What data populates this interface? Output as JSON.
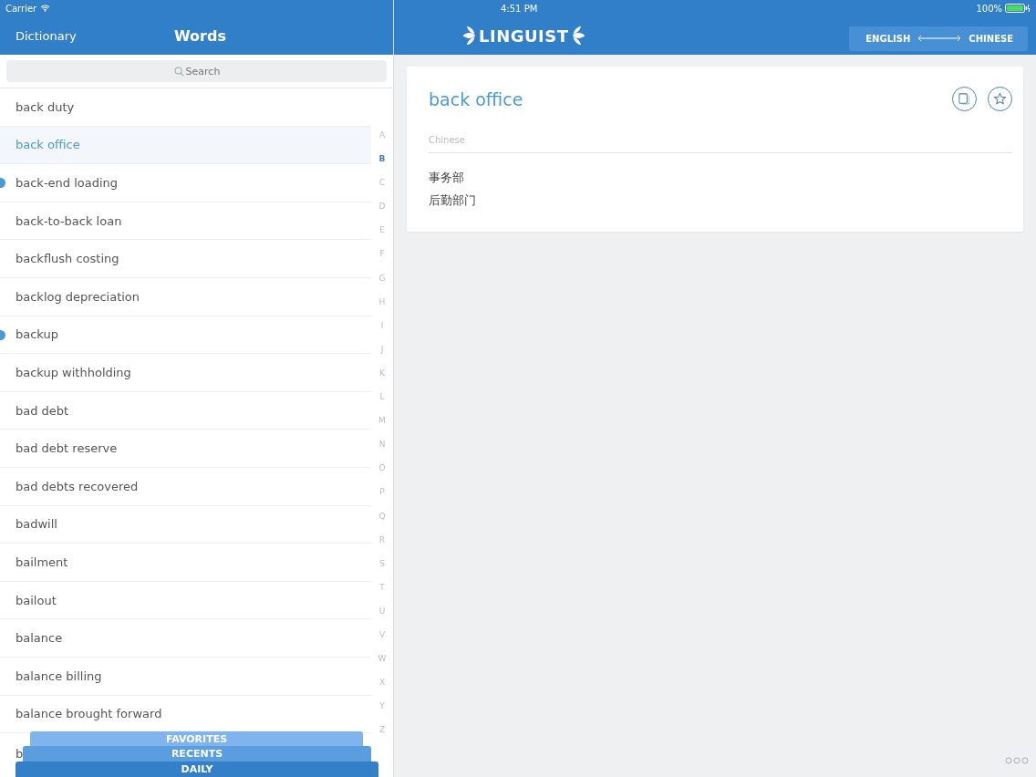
{
  "status_bar": {
    "carrier": "Carrier",
    "time": "4:51 PM",
    "battery": "100%"
  },
  "sidebar": {
    "back_button": "Dictionary",
    "title": "Words",
    "search": {
      "placeholder": "Search"
    },
    "rows": [
      {
        "label": "back duty",
        "selected": false,
        "marked": false
      },
      {
        "label": "back office",
        "selected": true,
        "marked": false
      },
      {
        "label": "back-end loading",
        "selected": false,
        "marked": true
      },
      {
        "label": "back-to-back loan",
        "selected": false,
        "marked": false
      },
      {
        "label": "backflush costing",
        "selected": false,
        "marked": false
      },
      {
        "label": "backlog depreciation",
        "selected": false,
        "marked": false
      },
      {
        "label": "backup",
        "selected": false,
        "marked": true
      },
      {
        "label": "backup withholding",
        "selected": false,
        "marked": false
      },
      {
        "label": "bad debt",
        "selected": false,
        "marked": false
      },
      {
        "label": "bad debt reserve",
        "selected": false,
        "marked": false
      },
      {
        "label": "bad debts recovered",
        "selected": false,
        "marked": false
      },
      {
        "label": "badwill",
        "selected": false,
        "marked": false
      },
      {
        "label": "bailment",
        "selected": false,
        "marked": false
      },
      {
        "label": "bailout",
        "selected": false,
        "marked": false
      },
      {
        "label": "balance",
        "selected": false,
        "marked": false
      },
      {
        "label": "balance billing",
        "selected": false,
        "marked": false
      },
      {
        "label": "balance brought forward",
        "selected": false,
        "marked": false
      },
      {
        "label": "b",
        "selected": false,
        "marked": false
      }
    ],
    "index": [
      {
        "letter": "A",
        "selected": false
      },
      {
        "letter": "B",
        "selected": true
      },
      {
        "letter": "C",
        "selected": false
      },
      {
        "letter": "D",
        "selected": false
      },
      {
        "letter": "E",
        "selected": false
      },
      {
        "letter": "F",
        "selected": false
      },
      {
        "letter": "G",
        "selected": false
      },
      {
        "letter": "H",
        "selected": false
      },
      {
        "letter": "I",
        "selected": false
      },
      {
        "letter": "J",
        "selected": false
      },
      {
        "letter": "K",
        "selected": false
      },
      {
        "letter": "L",
        "selected": false
      },
      {
        "letter": "M",
        "selected": false
      },
      {
        "letter": "N",
        "selected": false
      },
      {
        "letter": "O",
        "selected": false
      },
      {
        "letter": "P",
        "selected": false
      },
      {
        "letter": "Q",
        "selected": false
      },
      {
        "letter": "R",
        "selected": false
      },
      {
        "letter": "S",
        "selected": false
      },
      {
        "letter": "T",
        "selected": false
      },
      {
        "letter": "U",
        "selected": false
      },
      {
        "letter": "V",
        "selected": false
      },
      {
        "letter": "W",
        "selected": false
      },
      {
        "letter": "X",
        "selected": false
      },
      {
        "letter": "Y",
        "selected": false
      },
      {
        "letter": "Z",
        "selected": false
      }
    ],
    "bottom_tabs": [
      "FAVORITES",
      "RECENTS",
      "DAILY"
    ]
  },
  "header": {
    "logo": "LINGUIST",
    "language_from": "ENGLISH",
    "language_to": "CHINESE"
  },
  "entry": {
    "term": "back office",
    "field_label": "Chinese",
    "translations": [
      "事务部",
      "后勤部门"
    ]
  }
}
